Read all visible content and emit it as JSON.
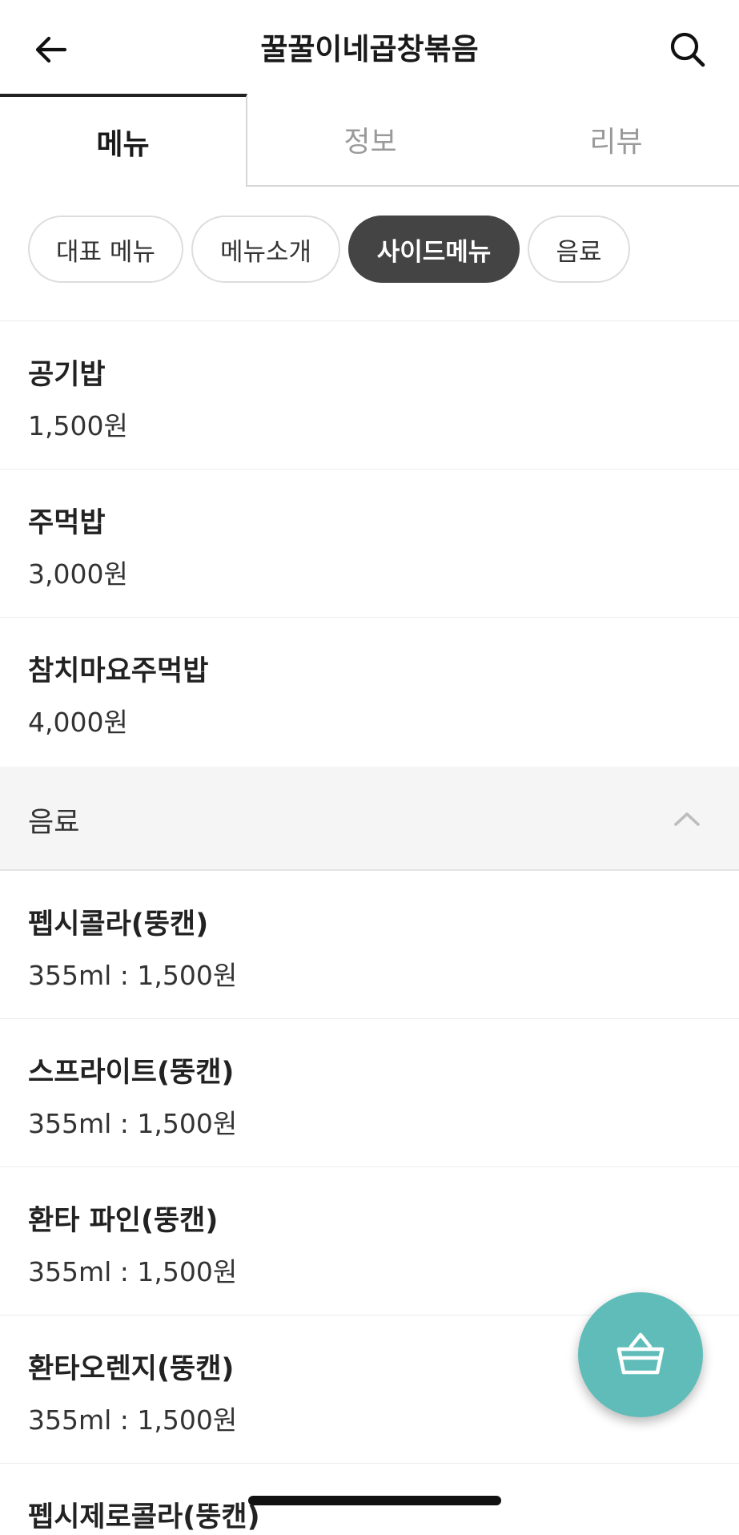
{
  "header": {
    "title": "꿀꿀이네곱창볶음",
    "back_icon": "arrow-left-icon",
    "search_icon": "search-icon"
  },
  "tabs": [
    {
      "label": "메뉴",
      "active": true
    },
    {
      "label": "정보",
      "active": false
    },
    {
      "label": "리뷰",
      "active": false
    }
  ],
  "chips": [
    {
      "label": "대표 메뉴",
      "active": false
    },
    {
      "label": "메뉴소개",
      "active": false
    },
    {
      "label": "사이드메뉴",
      "active": true
    },
    {
      "label": "음료",
      "active": false
    }
  ],
  "side_menu": [
    {
      "name": "공기밥",
      "price": "1,500원"
    },
    {
      "name": "주먹밥",
      "price": "3,000원"
    },
    {
      "name": "참치마요주먹밥",
      "price": "4,000원"
    }
  ],
  "drinks_section": {
    "title": "음료",
    "expanded": true,
    "chevron_icon": "chevron-up-icon"
  },
  "drinks": [
    {
      "name": "펩시콜라(뚱캔)",
      "price": "355ml : 1,500원"
    },
    {
      "name": "스프라이트(뚱캔)",
      "price": "355ml : 1,500원"
    },
    {
      "name": "환타 파인(뚱캔)",
      "price": "355ml : 1,500원"
    },
    {
      "name": "환타오렌지(뚱캔)",
      "price": "355ml : 1,500원"
    },
    {
      "name": "펩시제로콜라(뚱캔)",
      "price": ""
    }
  ],
  "cart": {
    "icon": "shopping-basket-icon",
    "color": "#5fbcb9"
  },
  "colors": {
    "active_chip_bg": "#444444",
    "section_bg": "#f5f5f5",
    "accent": "#5fbcb9"
  }
}
